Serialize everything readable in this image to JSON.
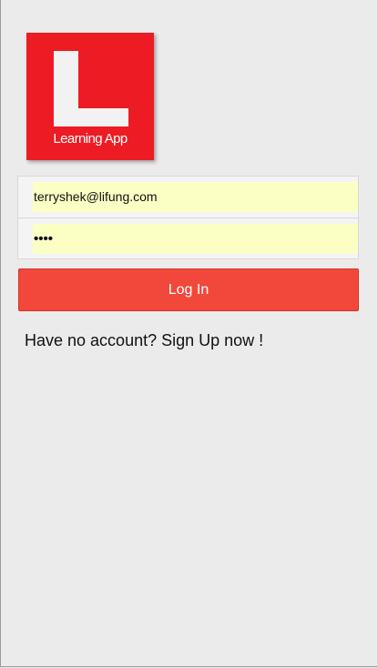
{
  "logo": {
    "letter": "L",
    "caption": "Learning App",
    "color": "#ed1c24"
  },
  "form": {
    "email_value": "terryshek@lifung.com",
    "password_value": "••••"
  },
  "login": {
    "label": "Log In",
    "color": "#f2483b"
  },
  "signup": {
    "text": "Have no account? Sign Up now !"
  }
}
